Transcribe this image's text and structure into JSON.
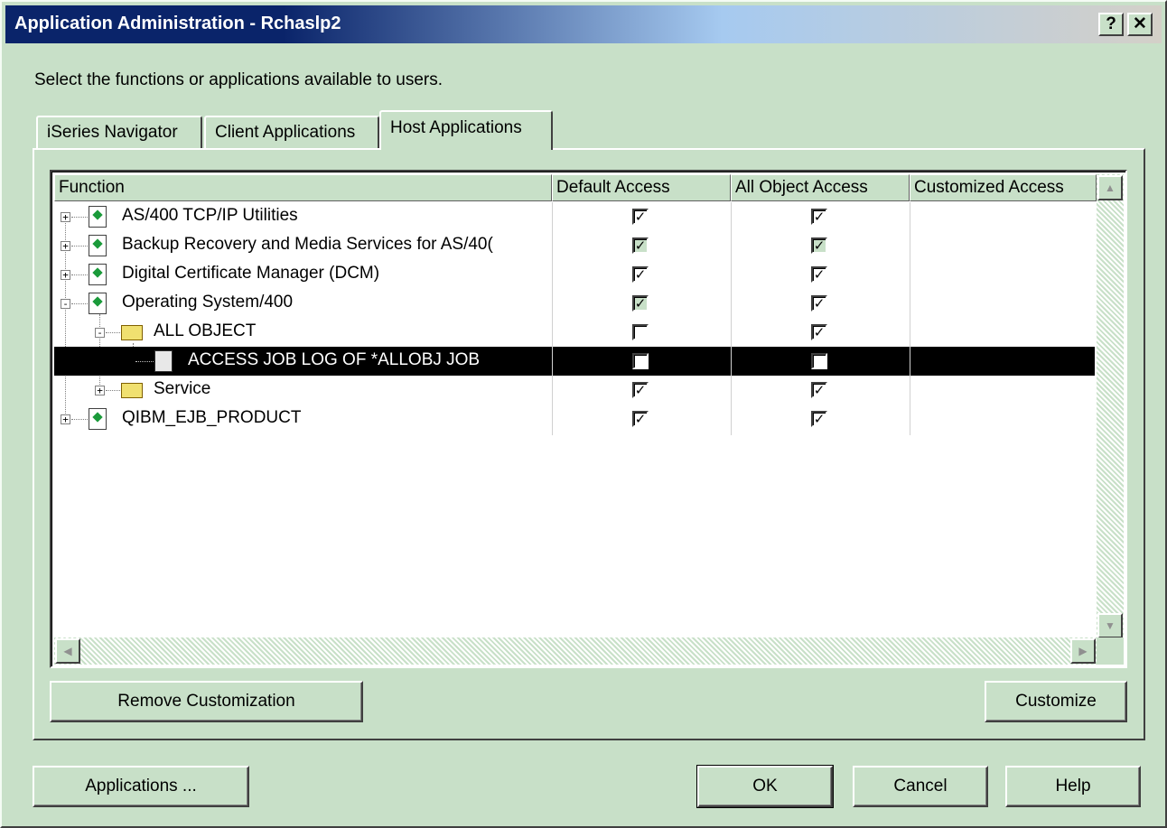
{
  "window": {
    "title": "Application Administration - Rchaslp2",
    "help_button": "?",
    "close_button": "✕",
    "instruction": "Select the functions or applications available to users."
  },
  "tabs": [
    {
      "label": "iSeries Navigator",
      "active": false
    },
    {
      "label": "Client Applications",
      "active": false
    },
    {
      "label": "Host Applications",
      "active": true
    }
  ],
  "table": {
    "columns": [
      "Function",
      "Default Access",
      "All Object Access",
      "Customized Access"
    ],
    "rows": [
      {
        "label": "AS/400 TCP/IP Utilities",
        "level": 0,
        "expander": "+",
        "icon": "application-icon",
        "default_access": "checked",
        "all_object_access": "checked",
        "selected": false
      },
      {
        "label": "Backup Recovery and Media Services for AS/40(",
        "level": 0,
        "expander": "+",
        "icon": "application-icon",
        "default_access": "checked-greyed",
        "all_object_access": "checked-greyed",
        "selected": false
      },
      {
        "label": "Digital Certificate Manager (DCM)",
        "level": 0,
        "expander": "+",
        "icon": "application-icon",
        "default_access": "checked",
        "all_object_access": "checked",
        "selected": false
      },
      {
        "label": "Operating System/400",
        "level": 0,
        "expander": "-",
        "icon": "application-icon",
        "default_access": "checked-greyed",
        "all_object_access": "checked",
        "selected": false
      },
      {
        "label": "ALL OBJECT",
        "level": 1,
        "expander": "-",
        "icon": "open-folder-icon",
        "default_access": "unchecked",
        "all_object_access": "checked",
        "selected": false
      },
      {
        "label": "ACCESS JOB LOG OF *ALLOBJ JOB",
        "level": 2,
        "expander": "",
        "icon": "lock-function-icon",
        "default_access": "unchecked",
        "all_object_access": "checked",
        "selected": true
      },
      {
        "label": "Service",
        "level": 1,
        "expander": "+",
        "icon": "folder-icon",
        "default_access": "checked",
        "all_object_access": "checked",
        "selected": false
      },
      {
        "label": "QIBM_EJB_PRODUCT",
        "level": 0,
        "expander": "+",
        "icon": "application-icon",
        "default_access": "checked",
        "all_object_access": "checked",
        "selected": false
      }
    ]
  },
  "buttons": {
    "remove_customization": "Remove Customization",
    "customize": "Customize",
    "applications": "Applications ...",
    "ok": "OK",
    "cancel": "Cancel",
    "help": "Help"
  },
  "colors": {
    "dialog_background": "#c8e0c8",
    "title_bar": "#0a246a",
    "selection": "#000000"
  }
}
